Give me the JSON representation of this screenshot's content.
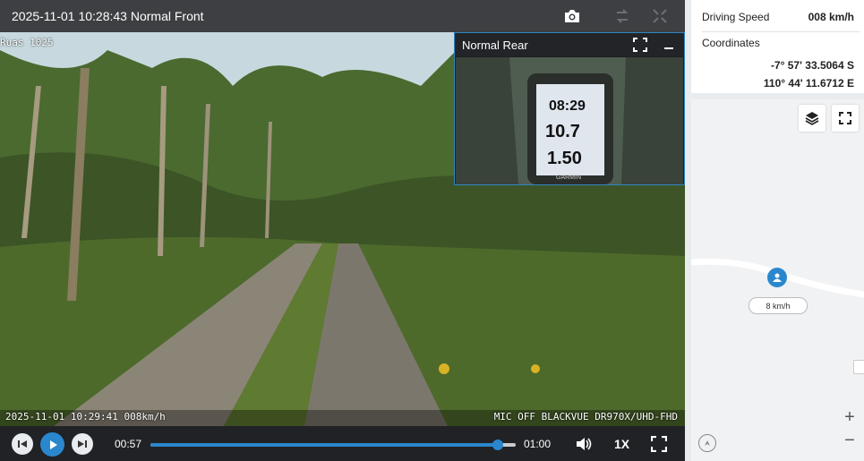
{
  "player": {
    "title": "2025-11-01 10:28:43 Normal Front",
    "clip_label": "Ruas 1025",
    "overlay_left": "2025-11-01 10:29:41 008km/h",
    "overlay_right": "MIC OFF BLACKVUE DR970X/UHD-FHD",
    "pip": {
      "title": "Normal Rear",
      "gps_time": "08:29",
      "gps_speed": "10.7",
      "gps_distance": "1.50",
      "gps_brand": "GARMIN"
    },
    "controls": {
      "current_time": "00:57",
      "total_time": "01:00",
      "progress": 0.95,
      "rate": "1X"
    },
    "icons": [
      "snapshot-icon",
      "swap-view-icon",
      "expand-arrows-icon",
      "prev-icon",
      "play-icon",
      "next-icon",
      "volume-icon",
      "fullscreen-icon"
    ]
  },
  "sidebar": {
    "speed_label": "Driving Speed",
    "speed_value": "008 km/h",
    "coords_label": "Coordinates",
    "latitude": "-7° 57' 33.5064 S",
    "longitude": "110° 44' 11.6712 E",
    "map": {
      "speed_tag": "8 km/h",
      "zoom_in": "+",
      "zoom_out": "−"
    }
  },
  "colors": {
    "accent": "#2b87cd",
    "topbar": "#3d3f42",
    "controls": "#202225"
  }
}
